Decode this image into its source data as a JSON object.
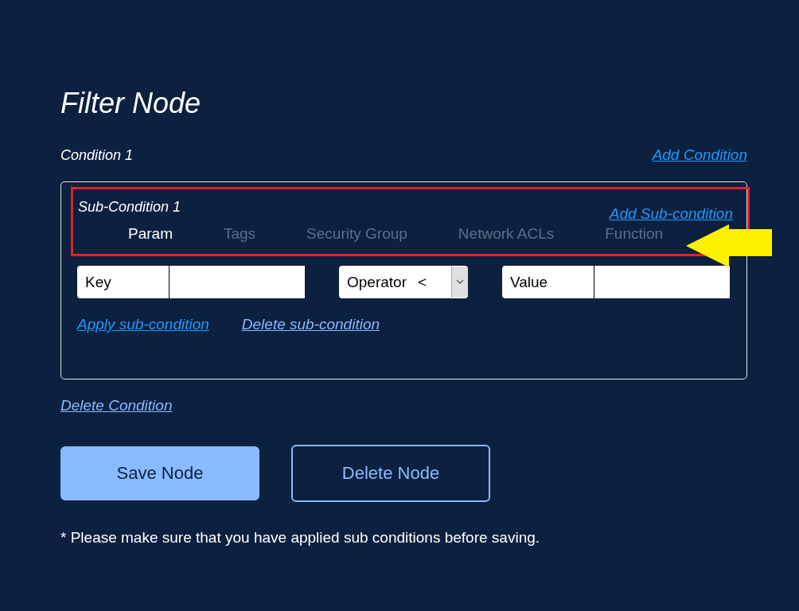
{
  "title": "Filter Node",
  "condition": {
    "label": "Condition 1",
    "add_link": {
      "label": "Add Condition",
      "kind": "primary"
    },
    "sub_condition": {
      "label": "Sub-Condition 1",
      "highlighted": true,
      "add_link": {
        "label": "Add Sub-condition",
        "kind": "primary"
      },
      "tabs": [
        {
          "label": "Param",
          "selected": true
        },
        {
          "label": "Tags",
          "selected": false
        },
        {
          "label": "Security Group",
          "selected": false
        },
        {
          "label": "Network ACLs",
          "selected": false
        },
        {
          "label": "Function",
          "selected": false
        }
      ],
      "key_field": {
        "label": "Key"
      },
      "operator": {
        "label": "Operator",
        "value": "<"
      },
      "value_field": {
        "label": "Value"
      },
      "links": [
        {
          "label": "Apply sub-condition",
          "kind": "primary"
        },
        {
          "label": "Delete sub-condition",
          "kind": "secondary"
        }
      ]
    },
    "delete_link": {
      "label": "Delete Condition",
      "kind": "secondary"
    }
  },
  "pointer_arrow": true,
  "buttons": [
    {
      "label": "Save Node",
      "kind": "primary"
    },
    {
      "label": "Delete Node",
      "kind": "outline"
    }
  ],
  "note": "* Please make sure that you have applied sub conditions before saving."
}
